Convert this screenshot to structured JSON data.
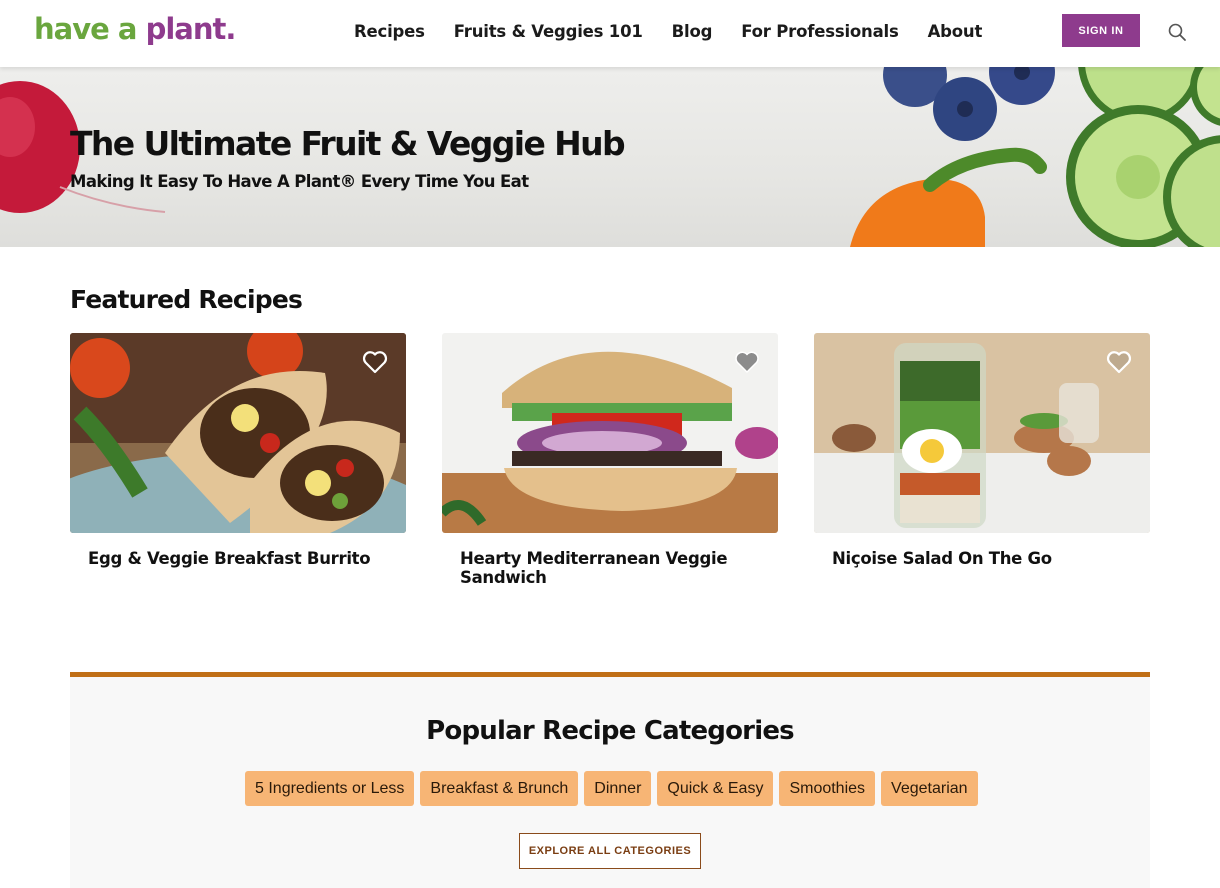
{
  "header": {
    "logo": {
      "part1": "have a",
      "part2": "plant",
      "registered": "."
    },
    "nav": [
      "Recipes",
      "Fruits & Veggies 101",
      "Blog",
      "For Professionals",
      "About"
    ],
    "sign_in": "SIGN IN",
    "search_icon": "search-icon"
  },
  "hero": {
    "title": "The Ultimate Fruit & Veggie Hub",
    "subtitle": "Making It Easy To Have A Plant® Every Time You Eat"
  },
  "featured": {
    "title": "Featured Recipes",
    "recipes": [
      {
        "title": "Egg & Veggie Breakfast Burrito",
        "icon": "heart-icon"
      },
      {
        "title": "Hearty Mediterranean Veggie Sandwich",
        "icon": "heart-icon"
      },
      {
        "title": "Niçoise Salad On The Go",
        "icon": "heart-icon"
      }
    ]
  },
  "categories": {
    "title": "Popular Recipe Categories",
    "chips": [
      "5 Ingredients or Less",
      "Breakfast & Brunch",
      "Dinner",
      "Quick & Easy",
      "Smoothies",
      "Vegetarian"
    ],
    "explore": "EXPLORE ALL CATEGORIES"
  },
  "colors": {
    "brand_green": "#6aa63e",
    "brand_purple": "#8e3b8d",
    "accent_orange": "#c06f16",
    "chip_bg": "#f7b575"
  }
}
